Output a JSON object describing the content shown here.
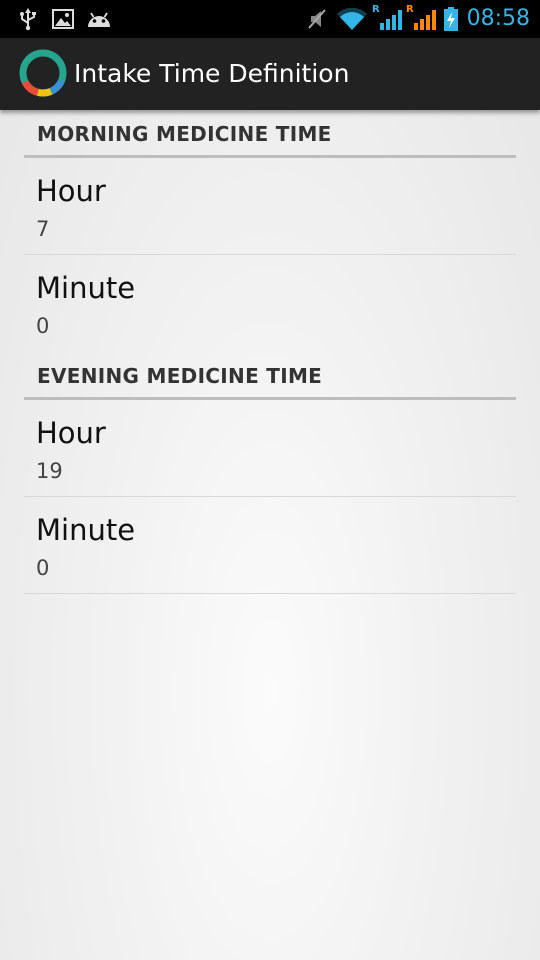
{
  "status_bar": {
    "time": "08:58",
    "icons": [
      "usb-icon",
      "image-icon",
      "android-icon",
      "mute-icon",
      "wifi-icon",
      "signal-icon-sim1",
      "signal-icon-sim2",
      "battery-charging-icon"
    ],
    "roaming_label_1": "R",
    "roaming_label_2": "R",
    "accent_color": "#33b5e5"
  },
  "action_bar": {
    "title": "Intake Time Definition",
    "logo_icon": "app-ring-logo-icon"
  },
  "sections": [
    {
      "header": "MORNING MEDICINE TIME",
      "items": [
        {
          "title": "Hour",
          "value": "7"
        },
        {
          "title": "Minute",
          "value": "0"
        }
      ]
    },
    {
      "header": "EVENING MEDICINE TIME",
      "items": [
        {
          "title": "Hour",
          "value": "19"
        },
        {
          "title": "Minute",
          "value": "0"
        }
      ]
    }
  ]
}
